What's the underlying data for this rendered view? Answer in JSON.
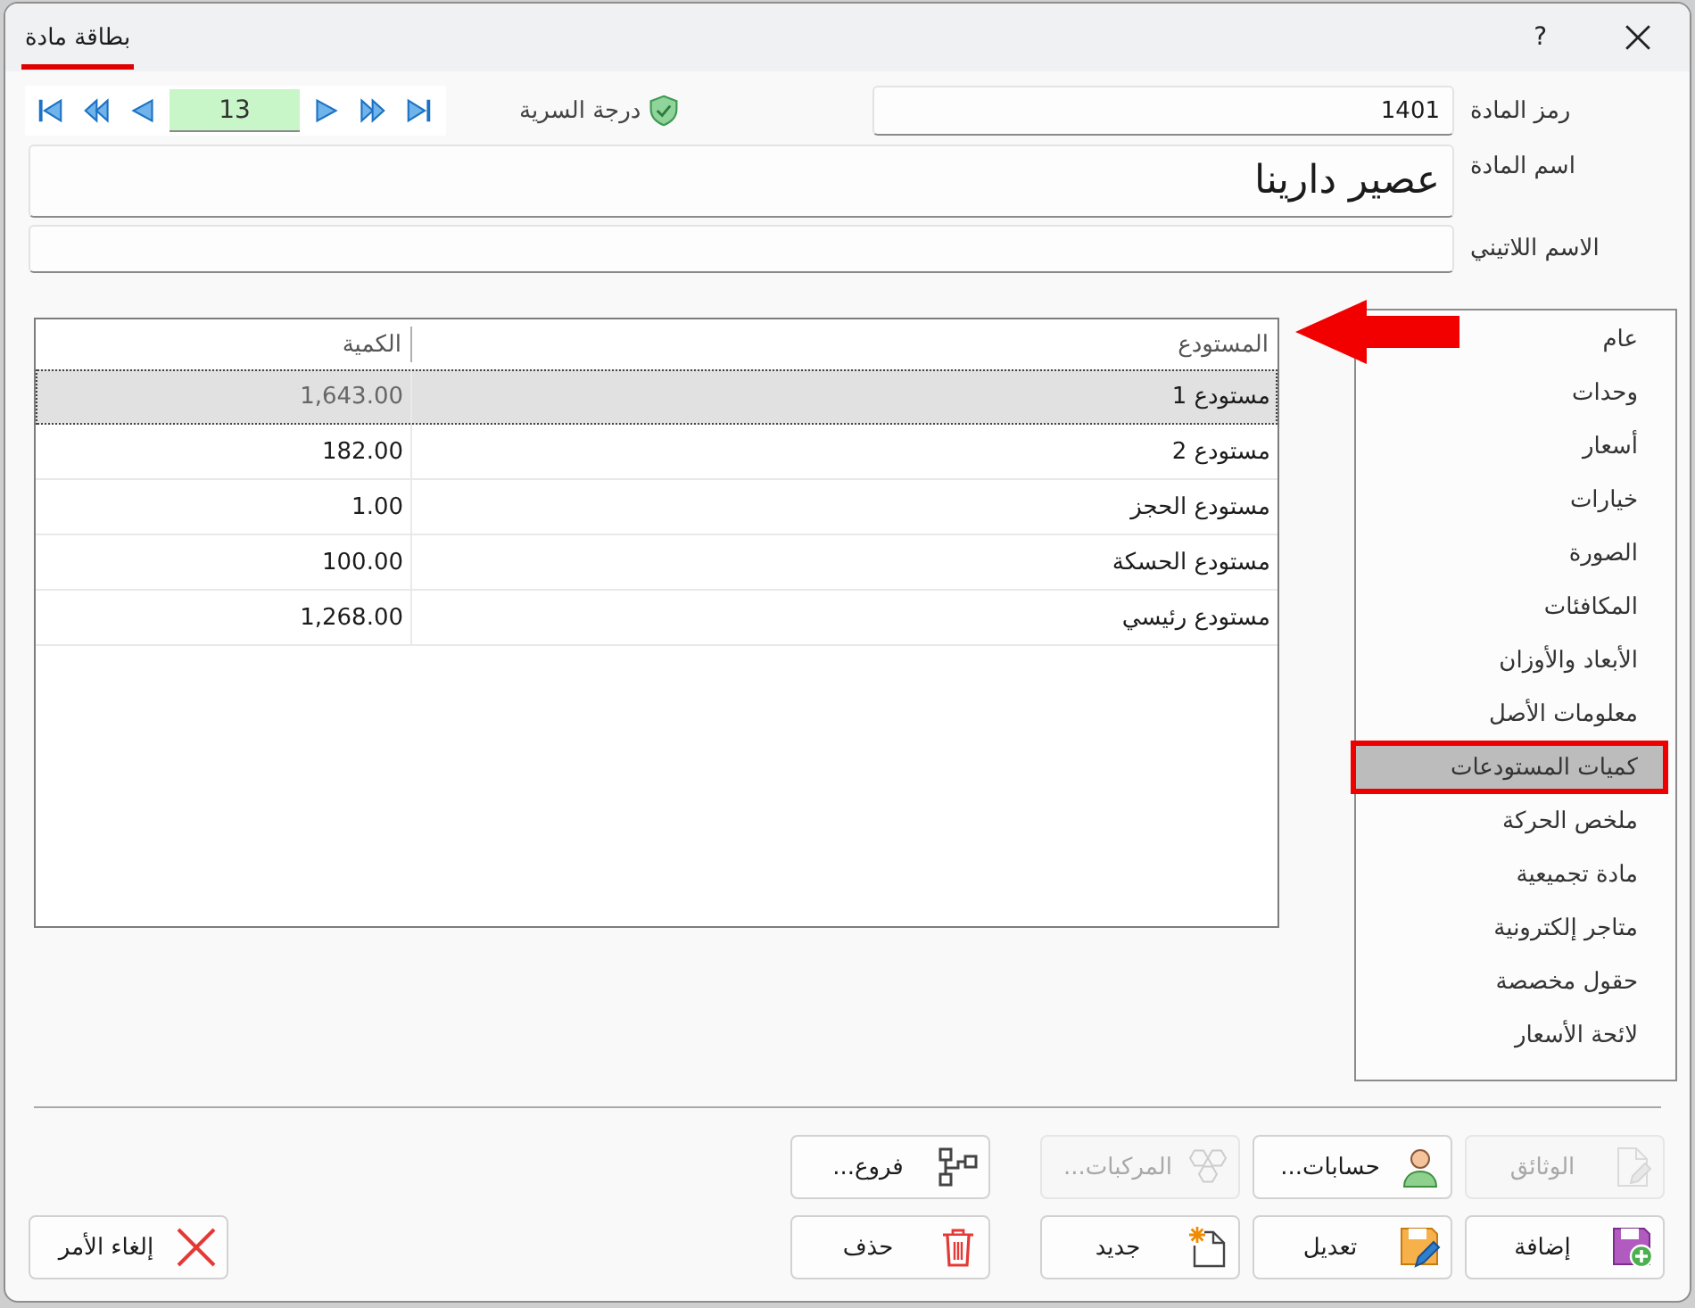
{
  "window": {
    "title": "بطاقة مادة",
    "help": "?"
  },
  "navigator": {
    "record": "13"
  },
  "security": {
    "label": "درجة السرية"
  },
  "code": {
    "label": "رمز المادة",
    "value": "1401"
  },
  "name": {
    "label": "اسم المادة",
    "value": "عصير دارينا"
  },
  "latin_name": {
    "label": "الاسم اللاتيني"
  },
  "table": {
    "columns": [
      "المستودع",
      "الكمية"
    ],
    "rows": [
      {
        "cells": [
          "مستودع 1",
          "1,643.00"
        ],
        "selected": true
      },
      {
        "cells": [
          "مستودع 2",
          "182.00"
        ],
        "selected": false
      },
      {
        "cells": [
          "مستودع الحجز",
          "1.00"
        ],
        "selected": false
      },
      {
        "cells": [
          "مستودع الحسكة",
          "100.00"
        ],
        "selected": false
      },
      {
        "cells": [
          "مستودع رئيسي",
          "1,268.00"
        ],
        "selected": false
      }
    ]
  },
  "sidebar": {
    "items": [
      {
        "label": "عام",
        "selected": false
      },
      {
        "label": "وحدات",
        "selected": false
      },
      {
        "label": "أسعار",
        "selected": false
      },
      {
        "label": "خيارات",
        "selected": false
      },
      {
        "label": "الصورة",
        "selected": false
      },
      {
        "label": "المكافئات",
        "selected": false
      },
      {
        "label": "الأبعاد والأوزان",
        "selected": false
      },
      {
        "label": "معلومات الأصل",
        "selected": false
      },
      {
        "label": "كميات المستودعات",
        "selected": true
      },
      {
        "label": "ملخص الحركة",
        "selected": false
      },
      {
        "label": "مادة تجميعية",
        "selected": false
      },
      {
        "label": "متاجر إلكترونية",
        "selected": false
      },
      {
        "label": "حقول مخصصة",
        "selected": false
      },
      {
        "label": "لائحة الأسعار",
        "selected": false
      }
    ]
  },
  "footer": {
    "rows": [
      [
        {
          "kind": "documents",
          "label": "الوثائق",
          "disabled": true
        },
        {
          "kind": "accounts",
          "label": "حسابات...",
          "disabled": false
        },
        {
          "kind": "components",
          "label": "المركبات...",
          "disabled": true
        },
        {
          "kind": "branches",
          "label": "فروع...",
          "disabled": false
        }
      ],
      [
        {
          "kind": "add",
          "label": "إضافة",
          "disabled": false
        },
        {
          "kind": "edit",
          "label": "تعديل",
          "disabled": false
        },
        {
          "kind": "new",
          "label": "جديد",
          "disabled": false
        },
        {
          "kind": "delete",
          "label": "حذف",
          "disabled": false
        },
        {
          "kind": "cancel",
          "label": "إلغاء الأمر",
          "disabled": false
        }
      ]
    ]
  }
}
